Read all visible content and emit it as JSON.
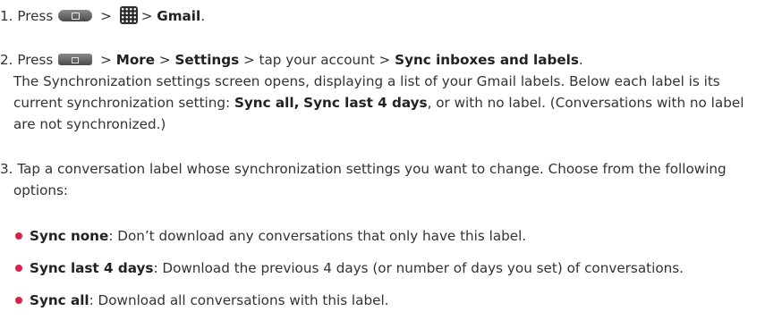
{
  "step1": {
    "num": "1.",
    "press": "Press",
    "sep1": ">",
    "sep2": ">",
    "gmail": "Gmail",
    "end": "."
  },
  "step2": {
    "num": "2.",
    "press": "Press",
    "sep1": ">",
    "more": "More",
    "sep2": ">",
    "settings": "Settings",
    "sep3": "> tap your account >",
    "sync_inboxes": "Sync inboxes and labels",
    "end": ".",
    "desc_a": "The Synchronization settings screen opens, displaying a list of your Gmail labels. Below each label is its current synchronization setting: ",
    "sync_all": "Sync all,",
    "sync_last": "Sync last 4 days",
    "desc_b": ", or with no label. (Conversations with no label are not synchronized.)"
  },
  "step3": {
    "text": "3. Tap a conversation label whose synchronization settings you want to change. Choose from the following options:"
  },
  "bullets": [
    {
      "term": "Sync none",
      "desc": ": Don’t download any conversations that only have this label."
    },
    {
      "term": "Sync last 4 days",
      "desc": ": Download the previous 4 days (or number of days you set) of conversations."
    },
    {
      "term": "Sync all",
      "desc": ": Download all conversations with this label."
    }
  ],
  "icons": {
    "home_key": "home-key-icon",
    "apps_key": "apps-icon",
    "menu_key": "menu-key-icon",
    "bullet_color": "#d9234b"
  }
}
